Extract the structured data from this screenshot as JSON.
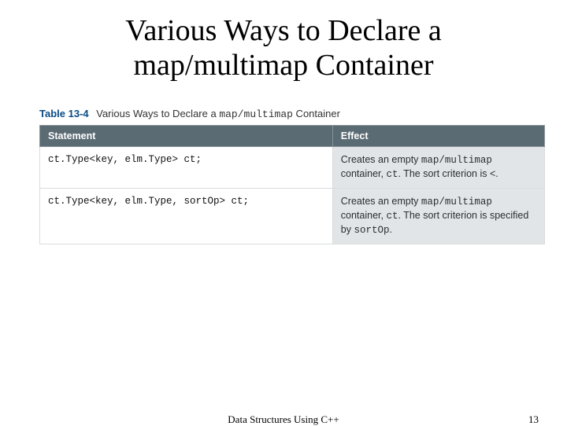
{
  "title_line1": "Various Ways to Declare a",
  "title_line2": "map/multimap Container",
  "caption": {
    "table_num": "Table 13-4",
    "pre": "Various Ways to Declare a ",
    "mono": "map/multimap",
    "post": " Container"
  },
  "headers": {
    "statement": "Statement",
    "effect": "Effect"
  },
  "rows": [
    {
      "stmt": "ct.Type<key, elm.Type> ct;",
      "eff_pre": "Creates an empty ",
      "eff_mono1": "map/multimap",
      "eff_mid": " container, ",
      "eff_mono2": "ct",
      "eff_post": ". The sort criterion is <."
    },
    {
      "stmt": "ct.Type<key, elm.Type, sortOp> ct;",
      "eff_pre": "Creates an empty ",
      "eff_mono1": "map/multimap",
      "eff_mid": " container, ",
      "eff_mono2": "ct",
      "eff_post1": ". The sort criterion is specified by ",
      "eff_mono3": "sortOp",
      "eff_post2": "."
    }
  ],
  "footer": {
    "book": "Data Structures Using C++",
    "page": "13"
  }
}
